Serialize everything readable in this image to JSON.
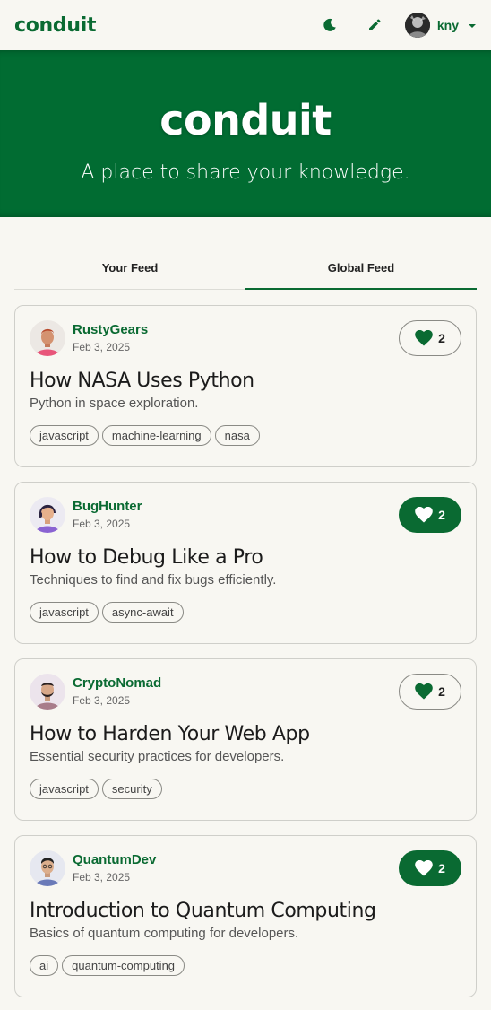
{
  "nav": {
    "brand": "conduit",
    "username": "kny",
    "icons": [
      "moon-icon",
      "pencil-icon",
      "caret-down-icon"
    ]
  },
  "banner": {
    "title": "conduit",
    "subtitle": "A place to share your knowledge."
  },
  "tabs": [
    {
      "label": "Your Feed",
      "active": false
    },
    {
      "label": "Global Feed",
      "active": true
    }
  ],
  "colors": {
    "brand": "#0a6a32",
    "banner": "#016c32",
    "background": "#f8f7f2"
  },
  "articles": [
    {
      "author": "RustyGears",
      "date": "Feb 3, 2025",
      "likes": "2",
      "liked": false,
      "title": "How NASA Uses Python",
      "description": "Python in space exploration.",
      "tags": [
        "javascript",
        "machine-learning",
        "nasa"
      ]
    },
    {
      "author": "BugHunter",
      "date": "Feb 3, 2025",
      "likes": "2",
      "liked": true,
      "title": "How to Debug Like a Pro",
      "description": "Techniques to find and fix bugs efficiently.",
      "tags": [
        "javascript",
        "async-await"
      ]
    },
    {
      "author": "CryptoNomad",
      "date": "Feb 3, 2025",
      "likes": "2",
      "liked": false,
      "title": "How to Harden Your Web App",
      "description": "Essential security practices for developers.",
      "tags": [
        "javascript",
        "security"
      ]
    },
    {
      "author": "QuantumDev",
      "date": "Feb 3, 2025",
      "likes": "2",
      "liked": true,
      "title": "Introduction to Quantum Computing",
      "description": "Basics of quantum computing for developers.",
      "tags": [
        "ai",
        "quantum-computing"
      ]
    }
  ]
}
